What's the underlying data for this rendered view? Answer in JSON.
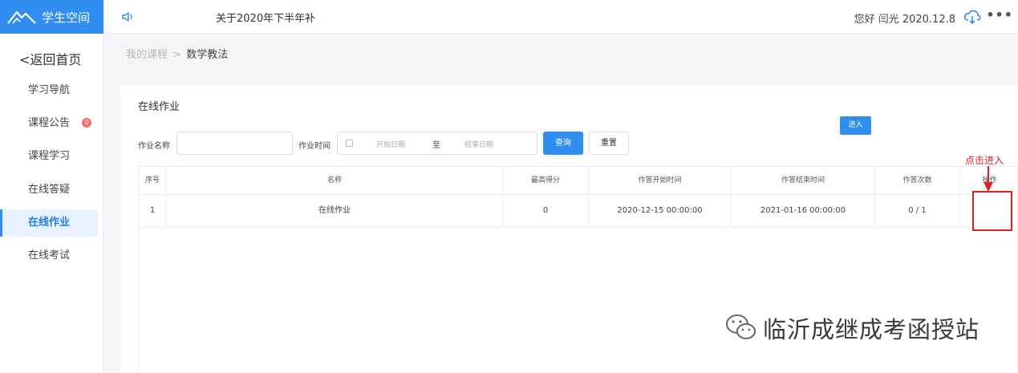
{
  "header": {
    "app_title": "学生空间",
    "notice_text": "关于2020年下半年补",
    "greeting": "您好 闫光 2020.12.8",
    "more_label": "•••"
  },
  "sidebar": {
    "back_label": "返回首页",
    "items": [
      {
        "label": "学习导航",
        "active": false
      },
      {
        "label": "课程公告",
        "active": false,
        "badge": "0"
      },
      {
        "label": "课程学习",
        "active": false
      },
      {
        "label": "在线答疑",
        "active": false
      },
      {
        "label": "在线作业",
        "active": true
      },
      {
        "label": "在线考试",
        "active": false
      }
    ]
  },
  "breadcrumb": {
    "parent": "我的课程",
    "separator": ">",
    "current": "数学教法"
  },
  "panel": {
    "title": "在线作业",
    "filters": {
      "name_label": "作业名称",
      "name_value": "",
      "time_label": "作业时间",
      "start_placeholder": "开始日期",
      "range_sep": "至",
      "end_placeholder": "结束日期",
      "search_label": "查询",
      "reset_label": "重置"
    },
    "table": {
      "columns": [
        "序号",
        "名称",
        "最高得分",
        "作答开始时间",
        "作答结束时间",
        "作答次数",
        "操作"
      ],
      "rows": [
        [
          "1",
          "在线作业",
          "0",
          "2020-12-15 00:00:00",
          "2021-01-16 00:00:00",
          "0 / 1",
          "进入"
        ]
      ]
    }
  },
  "annotation": {
    "text": "点击进入",
    "color": "#e02020"
  },
  "watermark": {
    "text": "临沂成继成考函授站"
  },
  "colors": {
    "accent": "#2f8ef0",
    "badge": "#f56c6c"
  }
}
